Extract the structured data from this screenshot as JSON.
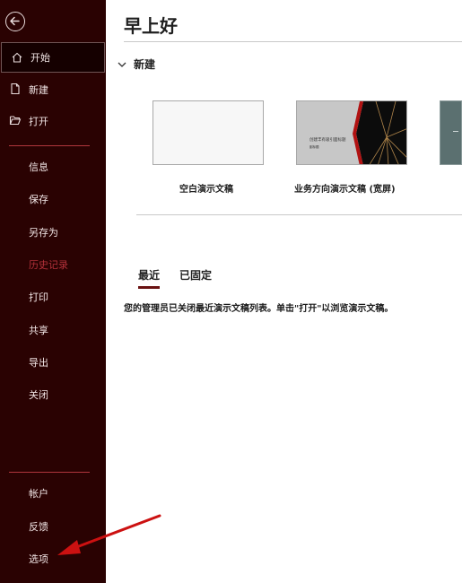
{
  "main": {
    "greeting": "早上好",
    "new_section": "新建",
    "templates": [
      {
        "label": "空白演示文稿"
      },
      {
        "label": "业务方向演示文稿 (宽屏)",
        "thumb_title": "创建丰有吸引面标题",
        "thumb_subtitle": "副标题"
      }
    ],
    "tabs": [
      {
        "label": "最近"
      },
      {
        "label": "已固定"
      }
    ],
    "notice": "您的管理员已关闭最近演示文稿列表。单击\"打开\"以浏览演示文稿。"
  },
  "sidebar": {
    "items": [
      {
        "label": "开始"
      },
      {
        "label": "新建"
      },
      {
        "label": "打开"
      },
      {
        "label": "信息"
      },
      {
        "label": "保存"
      },
      {
        "label": "另存为"
      },
      {
        "label": "历史记录"
      },
      {
        "label": "打印"
      },
      {
        "label": "共享"
      },
      {
        "label": "导出"
      },
      {
        "label": "关闭"
      },
      {
        "label": "帐户"
      },
      {
        "label": "反馈"
      },
      {
        "label": "选项"
      }
    ]
  },
  "colors": {
    "sidebar_bg": "#2a0202",
    "accent": "#6a1212",
    "disabled_text": "#b4313a",
    "annotation_arrow": "#cc1111"
  }
}
